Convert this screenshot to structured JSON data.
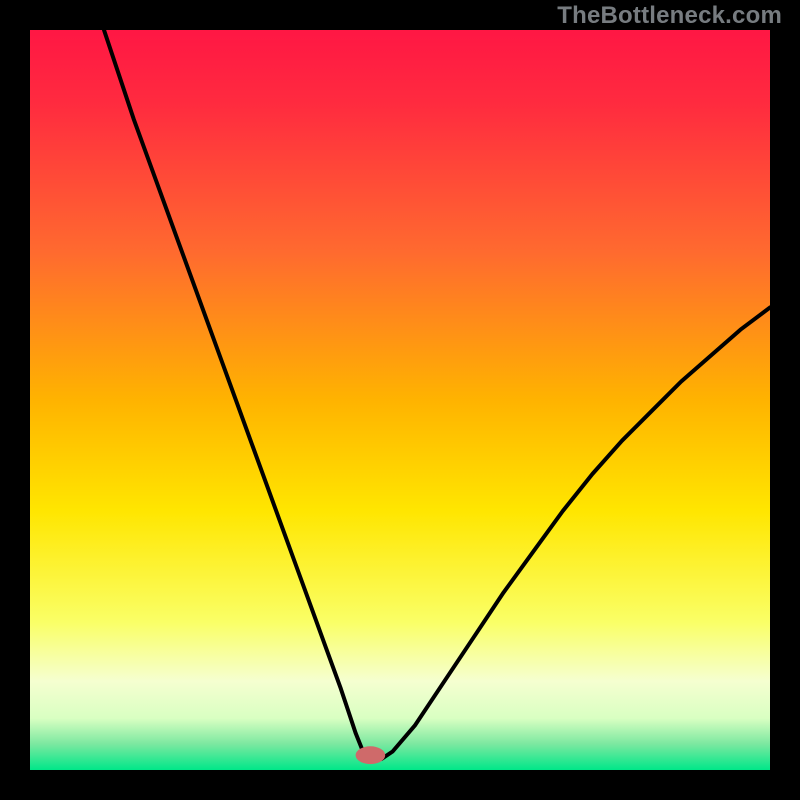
{
  "attribution": "TheBottleneck.com",
  "colors": {
    "frame": "#000000",
    "attribution_text": "#777c80",
    "curve": "#000000",
    "marker": "#cf6a6a",
    "gradient_stops": [
      {
        "offset": 0.0,
        "color": "#ff1744"
      },
      {
        "offset": 0.1,
        "color": "#ff2b3f"
      },
      {
        "offset": 0.3,
        "color": "#ff6a2f"
      },
      {
        "offset": 0.5,
        "color": "#ffb300"
      },
      {
        "offset": 0.65,
        "color": "#ffe600"
      },
      {
        "offset": 0.8,
        "color": "#faff66"
      },
      {
        "offset": 0.88,
        "color": "#f5ffd0"
      },
      {
        "offset": 0.93,
        "color": "#d9ffc2"
      },
      {
        "offset": 0.965,
        "color": "#7be8a0"
      },
      {
        "offset": 1.0,
        "color": "#00e789"
      }
    ]
  },
  "chart_data": {
    "type": "line",
    "title": "",
    "xlabel": "",
    "ylabel": "",
    "xlim": [
      0,
      100
    ],
    "ylim": [
      0,
      100
    ],
    "grid": false,
    "legend": false,
    "marker": {
      "x": 46,
      "y": 2,
      "rx": 2.0,
      "ry": 1.2,
      "color": "#cf6a6a"
    },
    "series": [
      {
        "name": "bottleneck-curve",
        "x": [
          10,
          12,
          14,
          16,
          18,
          20,
          22,
          24,
          26,
          28,
          30,
          32,
          34,
          36,
          38,
          40,
          42,
          43,
          44,
          45,
          46,
          47.5,
          49,
          52,
          56,
          60,
          64,
          68,
          72,
          76,
          80,
          84,
          88,
          92,
          96,
          100
        ],
        "values": [
          100,
          94,
          88,
          82.5,
          77,
          71.5,
          66,
          60.5,
          55,
          49.5,
          44,
          38.5,
          33,
          27.5,
          22,
          16.5,
          11,
          8,
          5,
          2.5,
          1.5,
          1.5,
          2.5,
          6,
          12,
          18,
          24,
          29.5,
          35,
          40,
          44.5,
          48.5,
          52.5,
          56,
          59.5,
          62.5
        ]
      }
    ]
  }
}
